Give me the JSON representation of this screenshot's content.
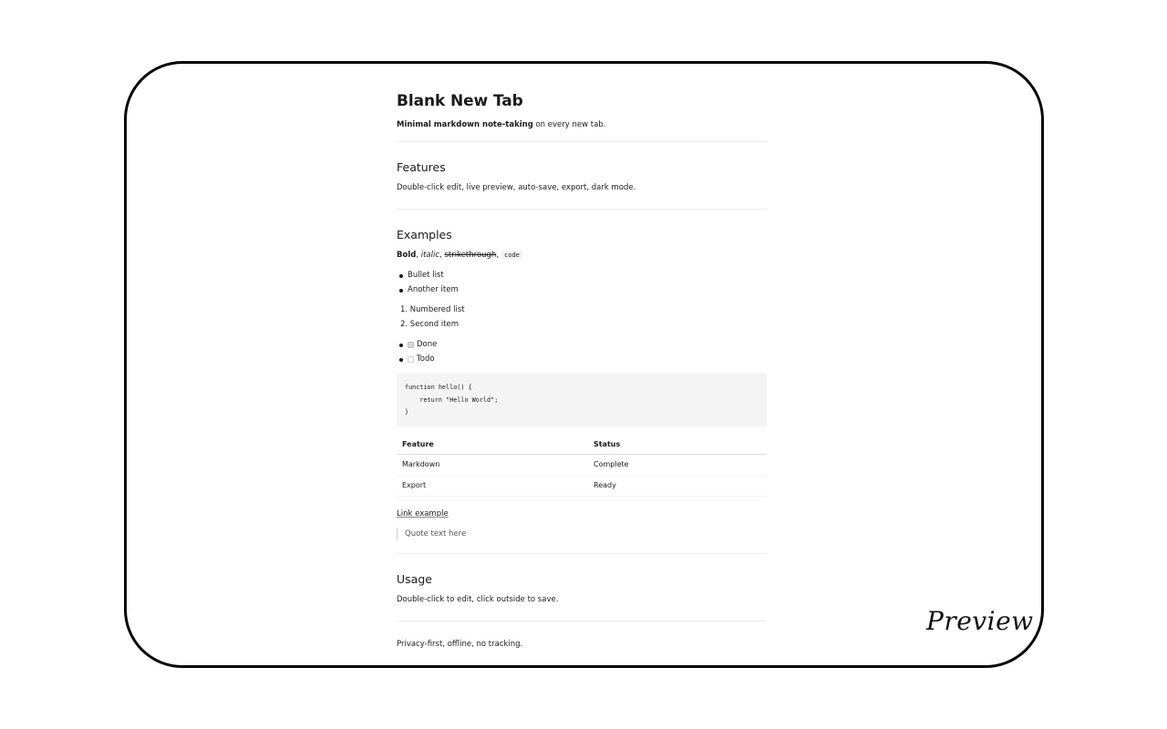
{
  "note": {
    "title": "Blank New Tab",
    "subtitle_bold": "Minimal markdown note-taking",
    "subtitle_rest": " on every new tab.",
    "features": {
      "heading": "Features",
      "text": "Double-click edit, live preview, auto-save, export, dark mode."
    },
    "examples": {
      "heading": "Examples",
      "bold": "Bold",
      "sep1": ", ",
      "italic": "italic",
      "sep2": ", ",
      "strike": "strikethrough",
      "sep3": ",",
      "code": "code",
      "bullets": [
        "Bullet list",
        "Another item"
      ],
      "numbered": [
        "1. Numbered list",
        "2. Second item"
      ],
      "tasks": [
        {
          "label": "Done",
          "checked": true
        },
        {
          "label": "Todo",
          "checked": false
        }
      ],
      "code_block": "function hello() {\n    return \"Hello World\";\n}",
      "table": {
        "headers": [
          "Feature",
          "Status"
        ],
        "rows": [
          [
            "Markdown",
            "Complete"
          ],
          [
            "Export",
            "Ready"
          ]
        ]
      },
      "link": "Link example",
      "quote": "Quote text here"
    },
    "usage": {
      "heading": "Usage",
      "text": "Double-click to edit, click outside to save."
    },
    "footer": "Privacy-first, offline, no tracking."
  },
  "overlay": {
    "preview_label": "Preview"
  }
}
